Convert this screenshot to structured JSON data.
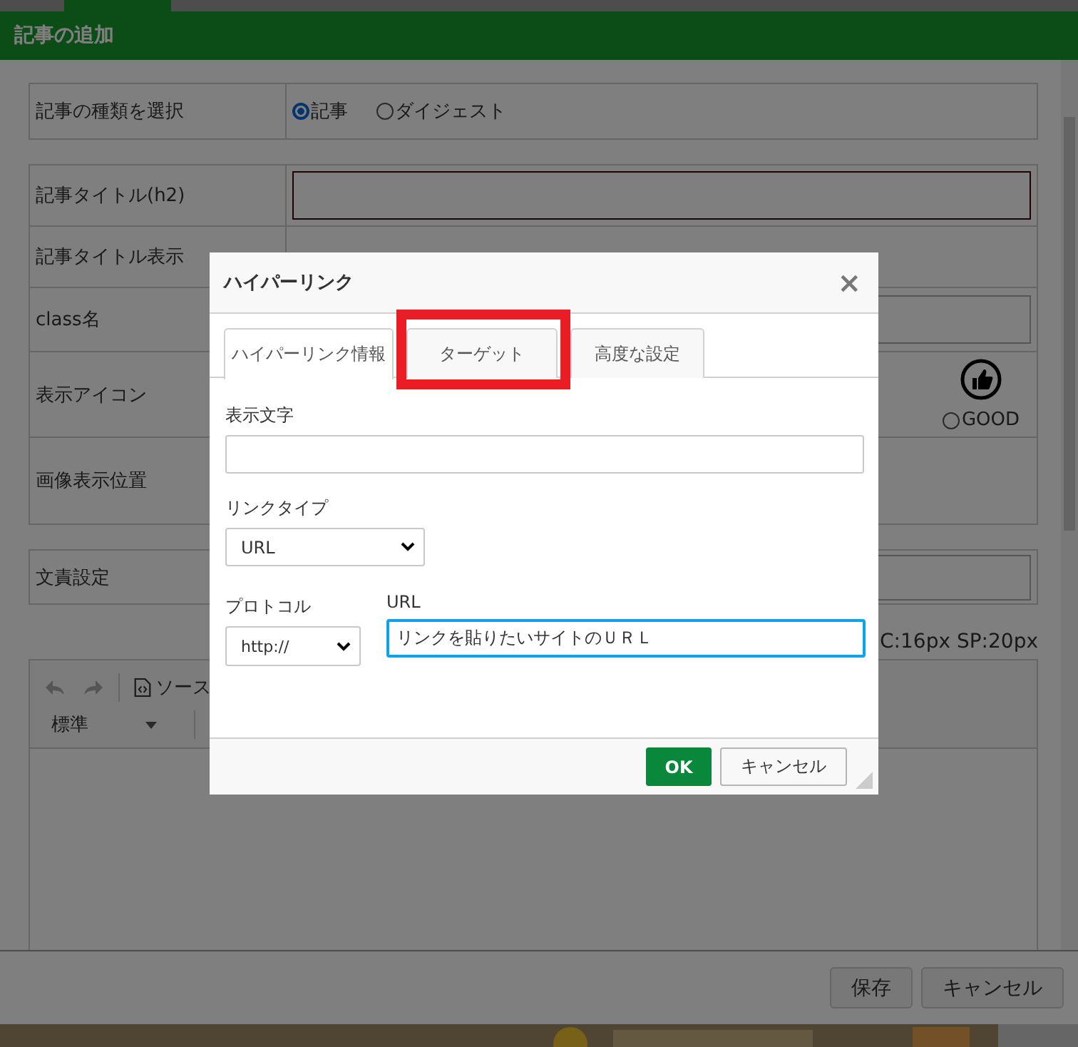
{
  "modal": {
    "title": "記事の追加",
    "type_row": {
      "label": "記事の種類を選択",
      "options": [
        {
          "label": "記事",
          "selected": true
        },
        {
          "label": "ダイジェスト",
          "selected": false
        }
      ]
    },
    "fields": [
      {
        "kind": "input",
        "label": "記事タイトル(h2)"
      },
      {
        "kind": "empty",
        "label": "記事タイトル表示"
      },
      {
        "kind": "input",
        "label": "class名"
      },
      {
        "kind": "icons",
        "label": "表示アイコン",
        "options": [
          {
            "label": "GOOD",
            "selected": false
          }
        ]
      },
      {
        "kind": "empty",
        "label": "画像表示位置"
      }
    ],
    "credit_row": {
      "label": "文責設定"
    },
    "size_note": "C:16px SP:20px",
    "editor": {
      "source_button": "ソース",
      "format_select": "標準"
    },
    "buttons": [
      "保存",
      "キャンセル"
    ]
  },
  "dialog": {
    "title": "ハイパーリンク",
    "close": "×",
    "tabs": [
      {
        "label": "ハイパーリンク情報",
        "selected": true,
        "highlighted": false
      },
      {
        "label": "ターゲット",
        "selected": false,
        "highlighted": true
      },
      {
        "label": "高度な設定",
        "selected": false,
        "highlighted": false
      }
    ],
    "display_text": {
      "label": "表示文字"
    },
    "link_type": {
      "label": "リンクタイプ",
      "value": "URL"
    },
    "protocol": {
      "label": "プロトコル",
      "value": "http://"
    },
    "url": {
      "label": "URL",
      "value": "リンクを貼りたいサイトのＵＲＬ"
    },
    "buttons": [
      {
        "label": "OK",
        "kind": "primary"
      },
      {
        "label": "キャンセル",
        "kind": "secondary"
      }
    ]
  }
}
